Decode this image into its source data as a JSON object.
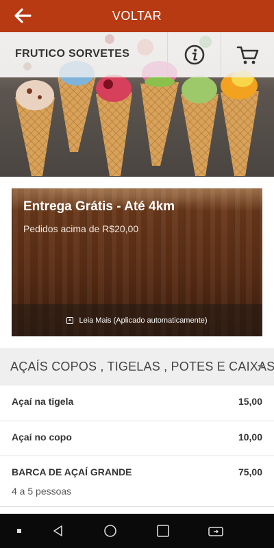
{
  "header": {
    "title": "VOLTAR",
    "back_icon": "arrow-left-icon"
  },
  "store": {
    "name": "FRUTICO SORVETES",
    "info_icon": "info-icon",
    "cart_icon": "cart-icon"
  },
  "promo": {
    "title": "Entrega Grátis - Até 4km",
    "subtitle": "Pedidos acima de R$20,00",
    "footer": "Leia Mais (Aplicado automaticamente)"
  },
  "menu": {
    "section_title": "AÇAÍS COPOS , TIGELAS , POTES E CAIXAS",
    "items": [
      {
        "name": "Açaí na tigela",
        "price": "15,00",
        "description": ""
      },
      {
        "name": "Açaí no copo",
        "price": "10,00",
        "description": ""
      },
      {
        "name": "BARCA DE AÇAÍ GRANDE",
        "price": "75,00",
        "description": "4 a 5 pessoas"
      }
    ]
  },
  "colors": {
    "header_bg": "#b83a12",
    "section_bg": "#efefef",
    "nav_bg": "#0a0a0a"
  }
}
